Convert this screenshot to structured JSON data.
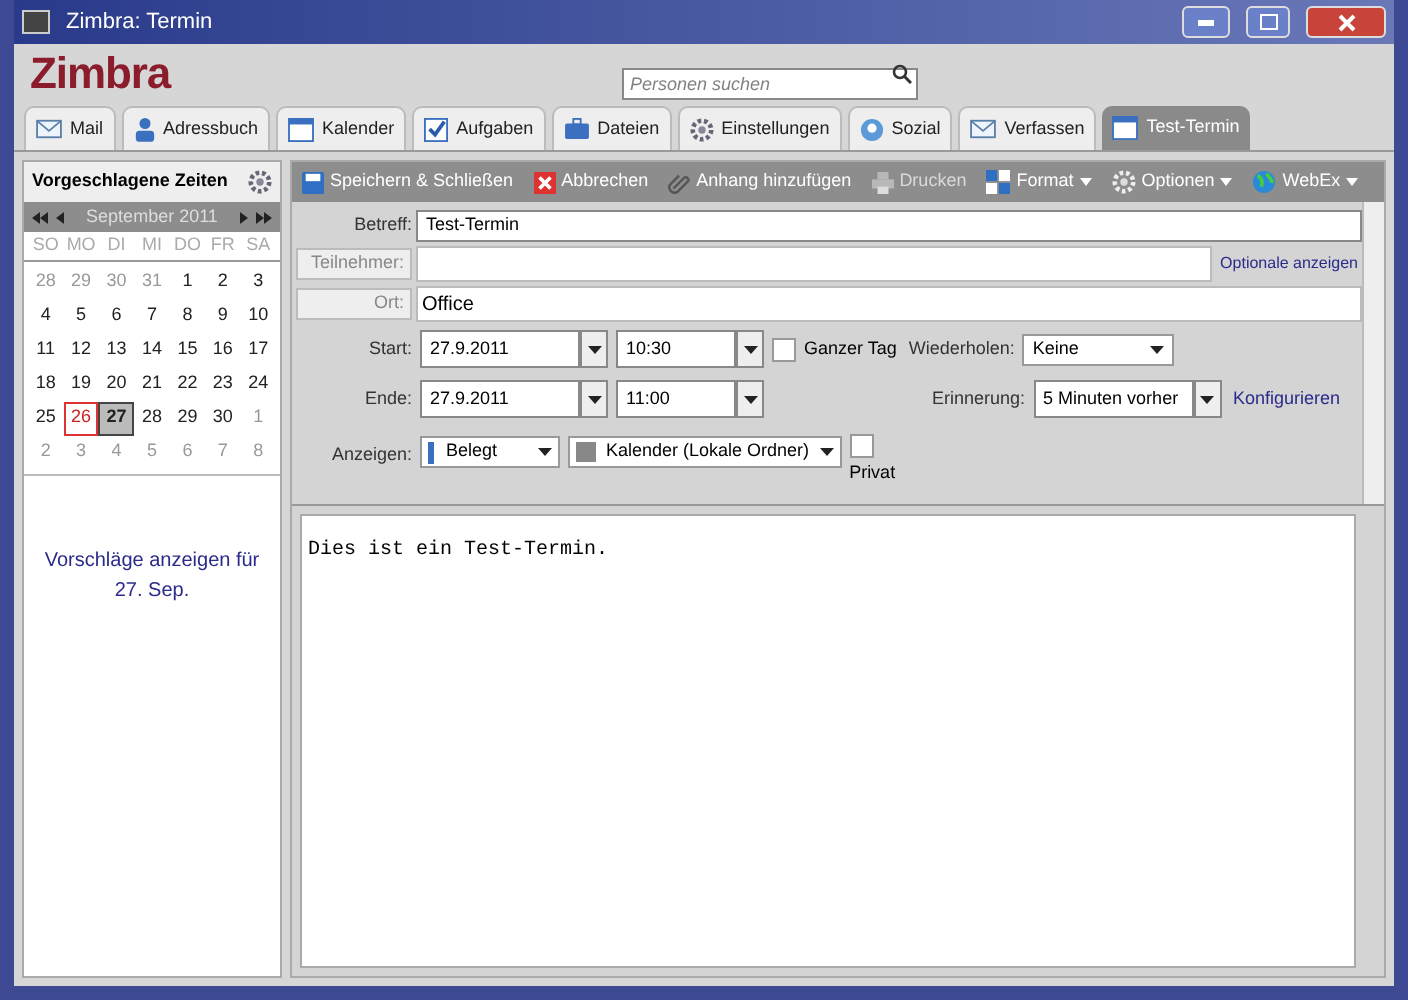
{
  "window": {
    "title": "Zimbra: Termin"
  },
  "app": {
    "logo": "Zimbra",
    "search": {
      "placeholder": "Personen suchen"
    }
  },
  "tabs": [
    {
      "label": "Mail",
      "kind": "mail",
      "selected": false
    },
    {
      "label": "Adressbuch",
      "kind": "contacts",
      "selected": false
    },
    {
      "label": "Kalender",
      "kind": "calendar",
      "selected": false
    },
    {
      "label": "Aufgaben",
      "kind": "tasks",
      "selected": false
    },
    {
      "label": "Dateien",
      "kind": "files",
      "selected": false
    },
    {
      "label": "Einstellungen",
      "kind": "settings",
      "selected": false
    },
    {
      "label": "Sozial",
      "kind": "social",
      "selected": false
    },
    {
      "label": "Verfassen",
      "kind": "mail",
      "selected": false
    },
    {
      "label": "Test-Termin",
      "kind": "calendar",
      "selected": true
    }
  ],
  "sidebar": {
    "title": "Vorgeschlagene Zeiten",
    "month": "September 2011",
    "weekdays": [
      "SO",
      "MO",
      "DI",
      "MI",
      "DO",
      "FR",
      "SA"
    ],
    "weeks": [
      [
        {
          "label": "28",
          "other_month": true,
          "today": false,
          "selected": false
        },
        {
          "label": "29",
          "other_month": true,
          "today": false,
          "selected": false
        },
        {
          "label": "30",
          "other_month": true,
          "today": false,
          "selected": false
        },
        {
          "label": "31",
          "other_month": true,
          "today": false,
          "selected": false
        },
        {
          "label": "1",
          "other_month": false,
          "today": false,
          "selected": false
        },
        {
          "label": "2",
          "other_month": false,
          "today": false,
          "selected": false
        },
        {
          "label": "3",
          "other_month": false,
          "today": false,
          "selected": false
        }
      ],
      [
        {
          "label": "4",
          "other_month": false,
          "today": false,
          "selected": false
        },
        {
          "label": "5",
          "other_month": false,
          "today": false,
          "selected": false
        },
        {
          "label": "6",
          "other_month": false,
          "today": false,
          "selected": false
        },
        {
          "label": "7",
          "other_month": false,
          "today": false,
          "selected": false
        },
        {
          "label": "8",
          "other_month": false,
          "today": false,
          "selected": false
        },
        {
          "label": "9",
          "other_month": false,
          "today": false,
          "selected": false
        },
        {
          "label": "10",
          "other_month": false,
          "today": false,
          "selected": false
        }
      ],
      [
        {
          "label": "11",
          "other_month": false,
          "today": false,
          "selected": false
        },
        {
          "label": "12",
          "other_month": false,
          "today": false,
          "selected": false
        },
        {
          "label": "13",
          "other_month": false,
          "today": false,
          "selected": false
        },
        {
          "label": "14",
          "other_month": false,
          "today": false,
          "selected": false
        },
        {
          "label": "15",
          "other_month": false,
          "today": false,
          "selected": false
        },
        {
          "label": "16",
          "other_month": false,
          "today": false,
          "selected": false
        },
        {
          "label": "17",
          "other_month": false,
          "today": false,
          "selected": false
        }
      ],
      [
        {
          "label": "18",
          "other_month": false,
          "today": false,
          "selected": false
        },
        {
          "label": "19",
          "other_month": false,
          "today": false,
          "selected": false
        },
        {
          "label": "20",
          "other_month": false,
          "today": false,
          "selected": false
        },
        {
          "label": "21",
          "other_month": false,
          "today": false,
          "selected": false
        },
        {
          "label": "22",
          "other_month": false,
          "today": false,
          "selected": false
        },
        {
          "label": "23",
          "other_month": false,
          "today": false,
          "selected": false
        },
        {
          "label": "24",
          "other_month": false,
          "today": false,
          "selected": false
        }
      ],
      [
        {
          "label": "25",
          "other_month": false,
          "today": false,
          "selected": false
        },
        {
          "label": "26",
          "other_month": false,
          "today": true,
          "selected": false
        },
        {
          "label": "27",
          "other_month": false,
          "today": false,
          "selected": true
        },
        {
          "label": "28",
          "other_month": false,
          "today": false,
          "selected": false
        },
        {
          "label": "29",
          "other_month": false,
          "today": false,
          "selected": false
        },
        {
          "label": "30",
          "other_month": false,
          "today": false,
          "selected": false
        },
        {
          "label": "1",
          "other_month": true,
          "today": false,
          "selected": false
        }
      ],
      [
        {
          "label": "2",
          "other_month": true,
          "today": false,
          "selected": false
        },
        {
          "label": "3",
          "other_month": true,
          "today": false,
          "selected": false
        },
        {
          "label": "4",
          "other_month": true,
          "today": false,
          "selected": false
        },
        {
          "label": "5",
          "other_month": true,
          "today": false,
          "selected": false
        },
        {
          "label": "6",
          "other_month": true,
          "today": false,
          "selected": false
        },
        {
          "label": "7",
          "other_month": true,
          "today": false,
          "selected": false
        },
        {
          "label": "8",
          "other_month": true,
          "today": false,
          "selected": false
        }
      ]
    ],
    "suggestion": "Vorschläge anzeigen für 27. Sep."
  },
  "toolbar": [
    {
      "label": "Speichern & Schließen",
      "kind": "save",
      "disabled": false,
      "menu": false
    },
    {
      "label": "Abbrechen",
      "kind": "cancel",
      "disabled": false,
      "menu": false
    },
    {
      "label": "Anhang hinzufügen",
      "kind": "attach",
      "disabled": false,
      "menu": false
    },
    {
      "label": "Drucken",
      "kind": "print",
      "disabled": true,
      "menu": false
    },
    {
      "label": "Format",
      "kind": "format",
      "disabled": false,
      "menu": true
    },
    {
      "label": "Optionen",
      "kind": "options",
      "disabled": false,
      "menu": true
    },
    {
      "label": "WebEx",
      "kind": "webex",
      "disabled": false,
      "menu": true
    }
  ],
  "form": {
    "subject": {
      "label": "Betreff:",
      "value": "Test-Termin"
    },
    "attendees": {
      "label": "Teilnehmer:",
      "link": "Optionale anzeigen"
    },
    "location": {
      "label": "Ort:",
      "value": "Office"
    },
    "start": {
      "label": "Start:",
      "date": "27.9.2011",
      "time": "10:30"
    },
    "all_day": {
      "label": "Ganzer Tag",
      "checked": false
    },
    "repeat": {
      "label": "Wiederholen:",
      "value": "Keine"
    },
    "end": {
      "label": "Ende:",
      "date": "27.9.2011",
      "time": "11:00"
    },
    "reminder": {
      "label": "Erinnerung:",
      "value": "5 Minuten vorher",
      "link": "Konfigurieren"
    },
    "show_as": {
      "label": "Anzeigen:",
      "value": "Belegt"
    },
    "calendar": {
      "value": "Kalender (Lokale Ordner)"
    },
    "private": {
      "label": "Privat",
      "checked": false
    }
  },
  "body": "Dies ist ein Test-Termin."
}
